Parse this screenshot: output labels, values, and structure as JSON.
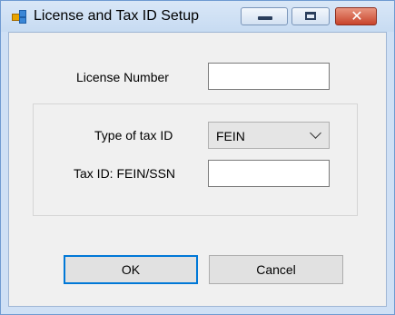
{
  "window": {
    "title": "License and Tax ID Setup",
    "close_glyph": "✕"
  },
  "form": {
    "license_number_label": "License Number",
    "license_number_value": "",
    "type_of_tax_id_label": "Type of tax ID",
    "type_of_tax_id_value": "FEIN",
    "tax_id_label": "Tax ID: FEIN/SSN",
    "tax_id_value": ""
  },
  "buttons": {
    "ok_label": "OK",
    "cancel_label": "Cancel"
  },
  "icons": {
    "app": "app-icon",
    "minimize": "minimize-icon",
    "maximize": "maximize-icon",
    "close": "close-icon",
    "dropdown": "chevron-down-icon"
  }
}
